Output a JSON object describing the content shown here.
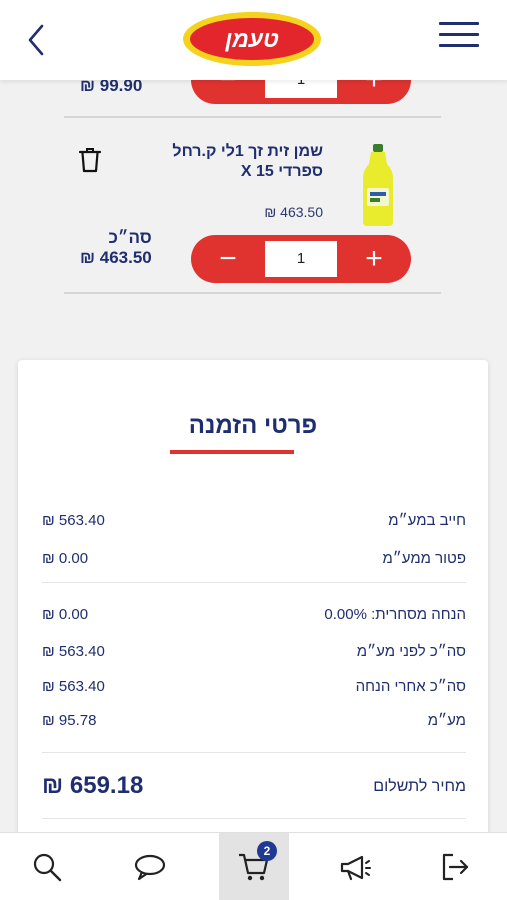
{
  "header": {
    "logo_text": "טעמן"
  },
  "cart": {
    "items": [
      {
        "total_label": "",
        "total_value": "₪ 99.90",
        "quantity": "1"
      },
      {
        "name": "שמן זית זך 1לי ק.רחל ספרדי X 15",
        "unit_price": "₪ 463.50",
        "total_label": "סה״כ",
        "total_value": "₪ 463.50",
        "quantity": "1"
      }
    ]
  },
  "summary": {
    "title": "פרטי הזמנה",
    "rows": [
      {
        "label": "חייב במע״מ",
        "value": "₪ 563.40"
      },
      {
        "label": "פטור ממע״מ",
        "value": "₪ 0.00"
      },
      {
        "label": "הנחה מסחרית: 0.00%",
        "value": "₪ 0.00"
      },
      {
        "label": "סה״כ לפני מע״מ",
        "value": "₪ 563.40"
      },
      {
        "label": "סה״כ אחרי הנחה",
        "value": "₪ 563.40"
      },
      {
        "label": "מע״מ",
        "value": "₪ 95.78"
      }
    ],
    "final": {
      "label": "מחיר לתשלום",
      "value": "₪ 659.18"
    }
  },
  "nav": {
    "cart_badge": "2"
  },
  "colors": {
    "brand_red": "#e0322f",
    "brand_yellow": "#f5d21b",
    "navy": "#1f2e6e"
  }
}
